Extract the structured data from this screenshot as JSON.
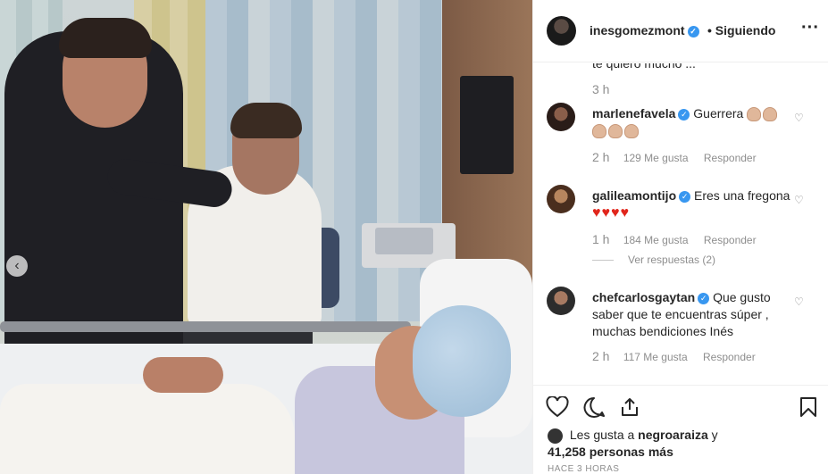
{
  "header": {
    "username": "inesgomezmont",
    "separator": "•",
    "follow_status": "Siguiendo",
    "more_icon": "more-dots-icon"
  },
  "feed": {
    "truncated_text": "te quiero mucho ...",
    "caption_time": "3 h",
    "comments": [
      {
        "user": "marlenefavela",
        "text": "Guerrera",
        "emoji": "clapping-hands x5",
        "time": "2 h",
        "likes": "129 Me gusta",
        "reply": "Responder"
      },
      {
        "user": "galileamontijo",
        "text": "Eres una fregona",
        "emoji": "red-heart x4",
        "time": "1 h",
        "likes": "184 Me gusta",
        "reply": "Responder",
        "view_replies": "Ver respuestas (2)"
      },
      {
        "user": "chefcarlosgaytan",
        "text": "Que gusto saber que te encuentras súper , muchas bendiciones Inés",
        "time": "2 h",
        "likes": "117 Me gusta",
        "reply": "Responder"
      }
    ]
  },
  "actions": {
    "like_icon": "heart-icon",
    "comment_icon": "comment-icon",
    "share_icon": "share-icon",
    "save_icon": "bookmark-icon"
  },
  "likes": {
    "prefix": "Les gusta a",
    "user": "negroaraiza",
    "connector": "y",
    "count": "41,258 personas más"
  },
  "post_age": "HACE 3 HORAS",
  "colors": {
    "verified": "#3897f0",
    "text": "#262626",
    "muted": "#8e8e8e",
    "heart": "#e1251b"
  }
}
